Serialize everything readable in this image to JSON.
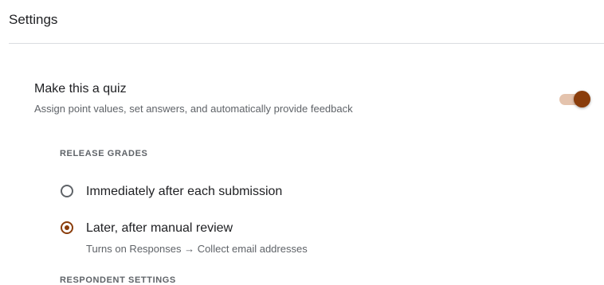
{
  "header": {
    "title": "Settings"
  },
  "quiz": {
    "title": "Make this a quiz",
    "description": "Assign point values, set answers, and automatically provide feedback",
    "enabled": true,
    "accent_color": "#8a3d0b",
    "track_color": "#e4c3ad"
  },
  "release_grades": {
    "heading": "RELEASE GRADES",
    "options": [
      {
        "label": "Immediately after each submission",
        "selected": false
      },
      {
        "label": "Later, after manual review",
        "sublabel": "Turns on Responses → Collect email addresses",
        "selected": true
      }
    ]
  },
  "respondent_settings": {
    "heading": "RESPONDENT SETTINGS"
  }
}
